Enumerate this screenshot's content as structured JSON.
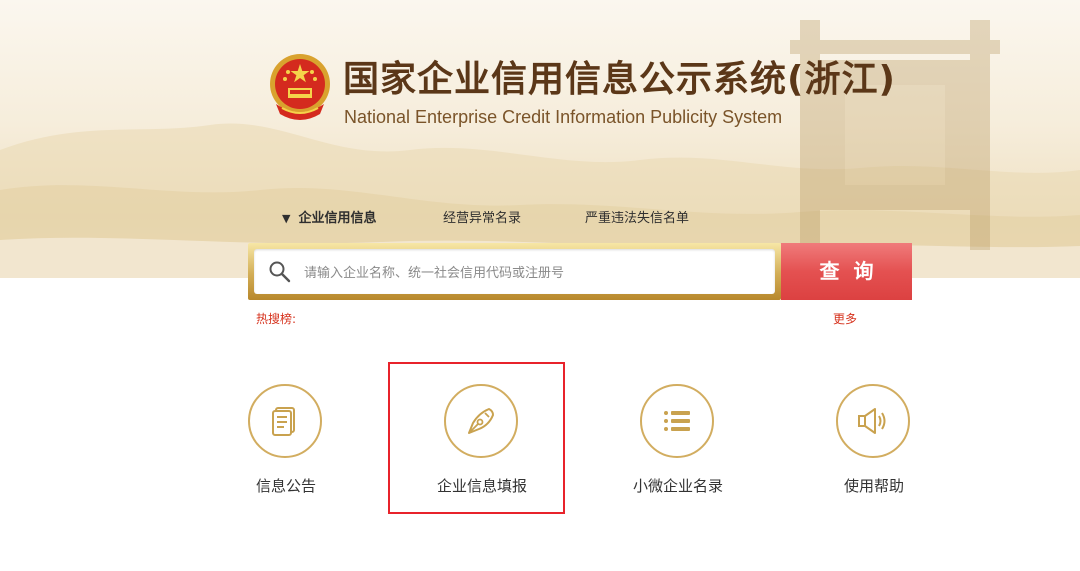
{
  "header": {
    "title": "国家企业信用信息公示系统(浙江)",
    "subtitle": "National Enterprise Credit Information Publicity System"
  },
  "nav": {
    "items": [
      {
        "label": "企业信用信息",
        "active": true
      },
      {
        "label": "经营异常名录",
        "active": false
      },
      {
        "label": "严重违法失信名单",
        "active": false
      }
    ]
  },
  "search": {
    "placeholder": "请输入企业名称、统一社会信用代码或注册号",
    "value": "",
    "button_label": "查询"
  },
  "hot": {
    "label": "热搜榜:",
    "more_label": "更多"
  },
  "features": [
    {
      "label": "信息公告",
      "icon": "document-icon"
    },
    {
      "label": "企业信息填报",
      "icon": "pen-icon",
      "highlighted": true
    },
    {
      "label": "小微企业名录",
      "icon": "list-icon"
    },
    {
      "label": "使用帮助",
      "icon": "speaker-icon"
    }
  ],
  "colors": {
    "title_brown": "#5b3718",
    "gold": "#d2ad60",
    "search_red": "#e45151",
    "hot_red": "#d6321d",
    "highlight_red": "#e8232b"
  }
}
